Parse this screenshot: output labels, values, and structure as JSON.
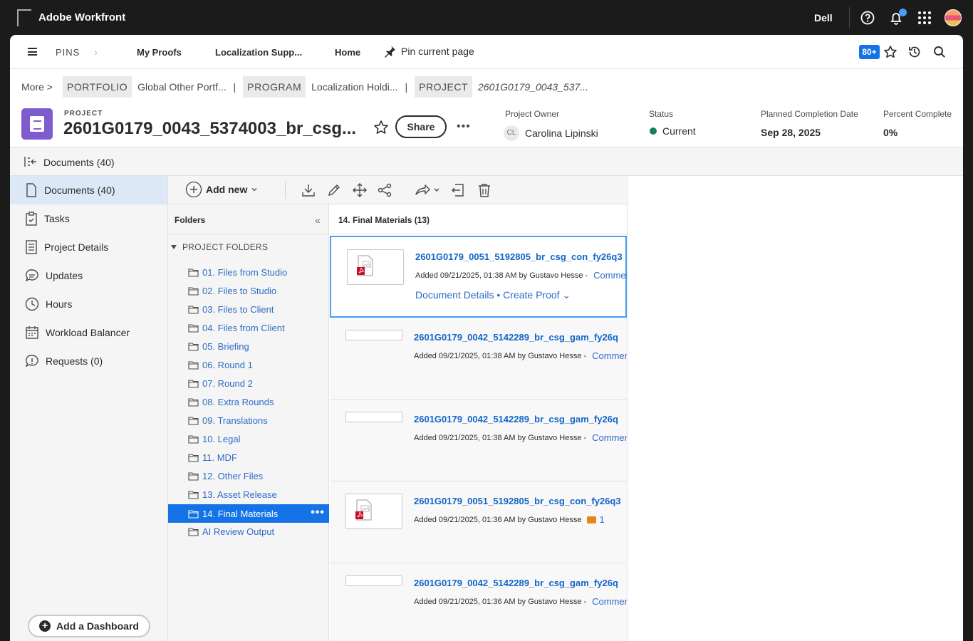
{
  "topbar": {
    "logo_alt": "Ado",
    "app_title": "Adobe Workfront",
    "org_name": "Dell",
    "icons": [
      "help-icon",
      "bell-icon",
      "apps-grid-icon",
      "user-avatar"
    ]
  },
  "pins": {
    "label": "PINS",
    "links": [
      "My Proofs",
      "Localization Supp...",
      "Home"
    ],
    "pin_current": "Pin current page",
    "badge": "80+"
  },
  "breadcrumb": {
    "more": "More",
    "portfolio_tag": "PORTFOLIO",
    "portfolio_value": "Global Other Portf...",
    "program_tag": "PROGRAM",
    "program_value": "Localization Holdi...",
    "project_tag": "PROJECT",
    "project_value": "2601G0179_0043_537..."
  },
  "project": {
    "kicker": "PROJECT",
    "title": "2601G0179_0043_5374003_br_csg...",
    "share_label": "Share",
    "more_label": "•••",
    "owner_label": "Project Owner",
    "owner_initials": "CL",
    "owner_name": "Carolina Lipinski",
    "status_label": "Status",
    "status_value": "Current",
    "status_color": "#12805c",
    "planned_label": "Planned Completion Date",
    "planned_value": "Sep 28, 2025",
    "percent_label": "Percent Complete",
    "percent_value": "0%"
  },
  "docsbar": {
    "label": "Documents (40)"
  },
  "leftnav": {
    "items": [
      {
        "label": "Documents (40)",
        "icon": "document-icon"
      },
      {
        "label": "Tasks",
        "icon": "clipboard-check-icon"
      },
      {
        "label": "Project Details",
        "icon": "details-icon"
      },
      {
        "label": "Updates",
        "icon": "speech-bubble-icon"
      },
      {
        "label": "Hours",
        "icon": "clock-icon"
      },
      {
        "label": "Workload Balancer",
        "icon": "calendar-icon"
      },
      {
        "label": "Requests (0)",
        "icon": "request-bubble-icon"
      }
    ],
    "add_dashboard": "Add a Dashboard"
  },
  "toolbar": {
    "add_new": "Add new",
    "tools": [
      "download-icon",
      "edit-pencil-icon",
      "move-icon",
      "share-icon",
      "send-arrow-icon",
      "release-icon",
      "trash-icon"
    ]
  },
  "folders": {
    "title": "Folders",
    "section": "PROJECT FOLDERS",
    "items": [
      "01. Files from Studio",
      "02. Files to Studio",
      "03. Files to Client",
      "04. Files from Client",
      "05. Briefing",
      "06. Round 1",
      "07. Round 2",
      "08. Extra Rounds",
      "09. Translations",
      "10. Legal",
      "11. MDF",
      "12. Other Files",
      "13. Asset Release",
      "14. Final Materials",
      "AI Review Output"
    ],
    "active_index": 13
  },
  "doclist": {
    "title": "14. Final Materials (13)",
    "rows": [
      {
        "name": "2601G0179_0051_5192805_br_csg_con_fy26q3",
        "meta": "Added 09/21/2025, 01:38 AM by Gustavo Hesse -",
        "comment": "Comments",
        "details": "Document Details •",
        "proof": "Create Proof ⌄"
      },
      {
        "name": "2601G0179_0042_5142289_br_csg_gam_fy26q",
        "meta": "Added 09/21/2025, 01:38 AM by Gustavo Hesse -",
        "comment": "Comments"
      },
      {
        "name": "2601G0179_0042_5142289_br_csg_gam_fy26q",
        "meta": "Added 09/21/2025, 01:38 AM by Gustavo Hesse -",
        "comment": "Comments"
      },
      {
        "name": "2601G0179_0051_5192805_br_csg_con_fy26q3",
        "meta": "Added 09/21/2025, 01:36 AM by Gustavo Hesse",
        "comment_count": "1"
      },
      {
        "name": "2601G0179_0042_5142289_br_csg_gam_fy26q",
        "meta": "Added 09/21/2025, 01:36 AM by Gustavo Hesse -",
        "comment": "Comments"
      }
    ]
  },
  "colors": {
    "accent": "#1473e6",
    "link": "#2e6cc6",
    "project_icon": "#7e5ccf"
  }
}
